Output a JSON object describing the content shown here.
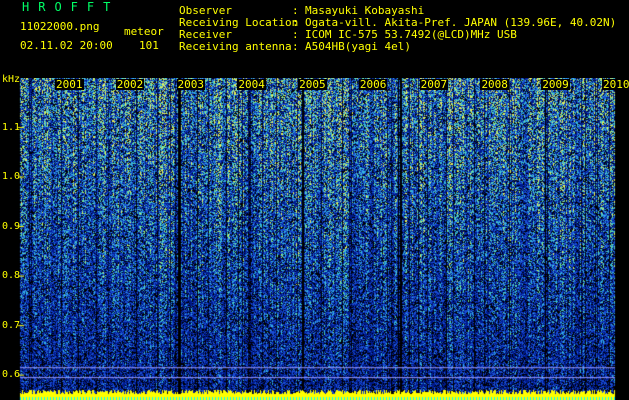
{
  "header": {
    "brand": "HROFFT",
    "filename": "11022000.png",
    "meteor_label": "meteor",
    "datetime": "02.11.02 20:00",
    "meteor_count": "101",
    "fields": [
      {
        "label": "Observer",
        "value": "Masayuki Kobayashi"
      },
      {
        "label": "Receiving Location",
        "value": "Ogata-vill. Akita-Pref. JAPAN (139.96E, 40.02N)"
      },
      {
        "label": "Receiver",
        "value": "ICOM IC-575 53.7492(@LCD)MHz USB"
      },
      {
        "label": "Receiving antenna",
        "value": "A504HB(yagi 4el)"
      }
    ]
  },
  "chart_data": {
    "type": "heatmap",
    "ylabel": "kHz",
    "y_ticks": [
      "1.1",
      "1.0",
      "0.9",
      "0.8",
      "0.7",
      "0.6"
    ],
    "ylim": [
      0.57,
      1.2
    ],
    "x_ticks": [
      "2001",
      "2002",
      "2003",
      "2004",
      "2005",
      "2006",
      "2007",
      "2008",
      "2009",
      "2010"
    ],
    "colors": [
      "#000000",
      "#001a8c",
      "#1a4fd6",
      "#35b8e0",
      "#6fe6a0",
      "#e8f25a"
    ],
    "bottom_band_color": "#ffff00"
  }
}
